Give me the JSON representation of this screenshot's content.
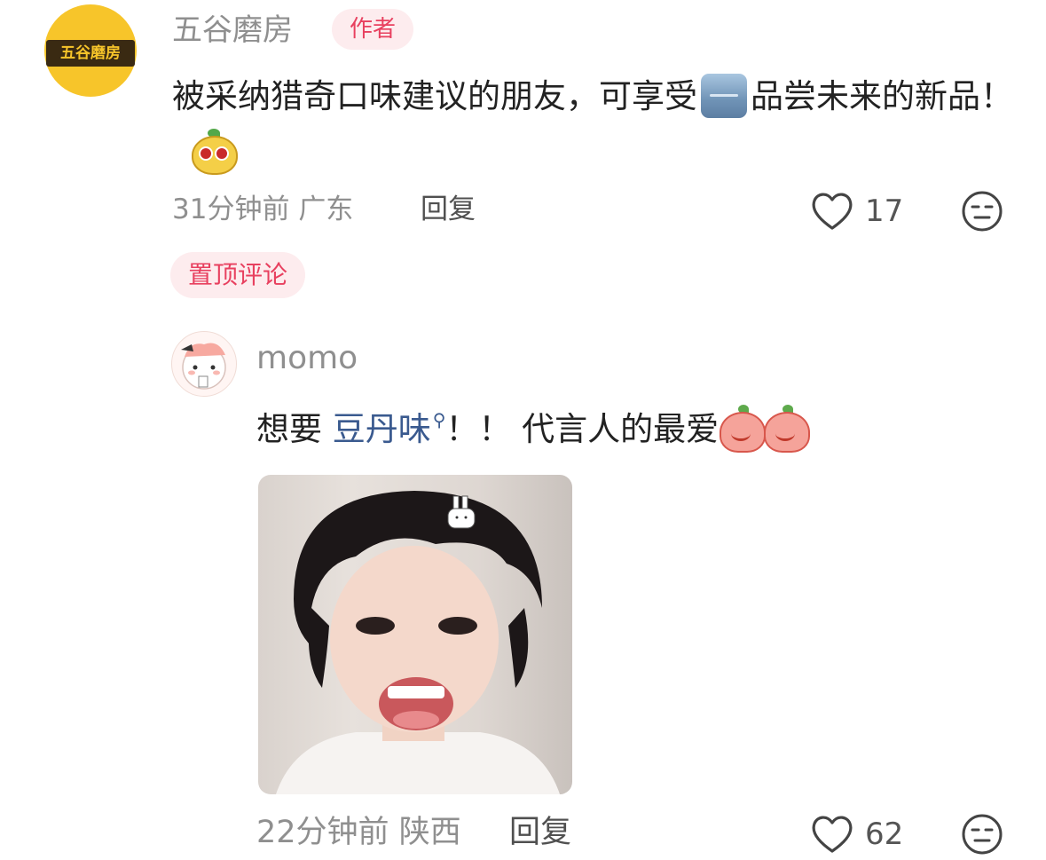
{
  "comment": {
    "author": "五谷磨房",
    "author_badge": "作者",
    "avatar_text": "五谷磨房",
    "text_before_emoji": "被采纳猎奇口味建议的朋友，可享受",
    "text_after_emoji": "品尝未来的新品！",
    "emoji_1": "blue-box-emoji",
    "emoji_2": "mascot-emoji",
    "time": "31分钟前",
    "location": "广东",
    "reply_label": "回复",
    "likes": "17",
    "pinned_label": "置顶评论"
  },
  "reply": {
    "author": "momo",
    "text_prefix": "想要 ",
    "link_text": "豆丹味",
    "text_suffix": "！！ 代言人的最爱",
    "emoji": "peach-emoji",
    "time": "22分钟前",
    "location": "陕西",
    "reply_label": "回复",
    "likes": "62",
    "image": "photo-of-person-smiling"
  },
  "colors": {
    "accent_red": "#e8405f",
    "badge_bg": "#fdecee",
    "link": "#3a5a8f",
    "meta_gray": "#8f8f8f",
    "brand_yellow": "#f7c52a"
  }
}
